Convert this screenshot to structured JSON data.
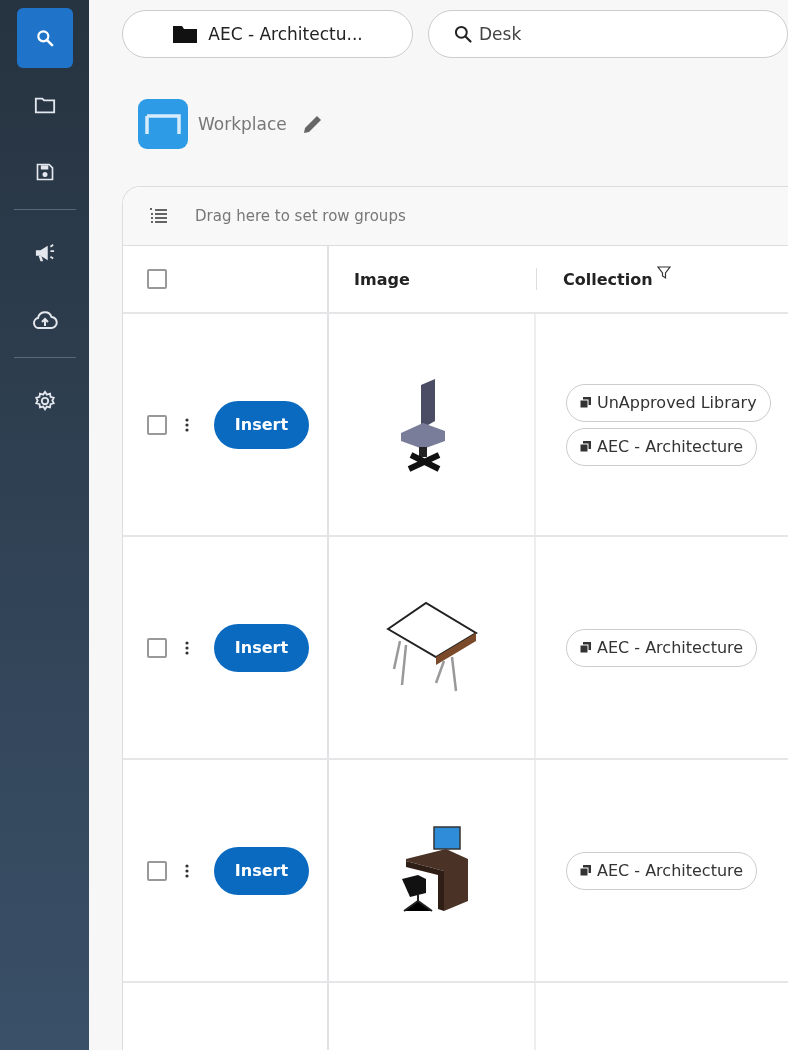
{
  "sidebar": {
    "items": [
      {
        "kind": "search",
        "selected": true
      },
      {
        "kind": "folder",
        "selected": false
      },
      {
        "kind": "save",
        "selected": false
      },
      {
        "kind": "divider"
      },
      {
        "kind": "megaphone",
        "selected": false
      },
      {
        "kind": "upload",
        "selected": false
      },
      {
        "kind": "divider"
      },
      {
        "kind": "settings",
        "selected": false
      }
    ]
  },
  "toolbar": {
    "collection": "AEC - Architectu...",
    "search": {
      "value": "Desk"
    }
  },
  "category": {
    "label": "Workplace"
  },
  "grid": {
    "group_hint": "Drag here to set row groups",
    "select_all": {
      "checked": false
    },
    "columns": [
      "Image",
      "Collection"
    ],
    "rows": [
      {
        "checked": false,
        "action": "Insert",
        "kind": "chair",
        "collections": [
          "UnApproved Library",
          "AEC - Architecture"
        ]
      },
      {
        "checked": false,
        "action": "Insert",
        "kind": "drafting-table",
        "collections": [
          "AEC - Architecture"
        ]
      },
      {
        "checked": false,
        "action": "Insert",
        "kind": "desk",
        "collections": [
          "AEC - Architecture"
        ]
      }
    ]
  }
}
